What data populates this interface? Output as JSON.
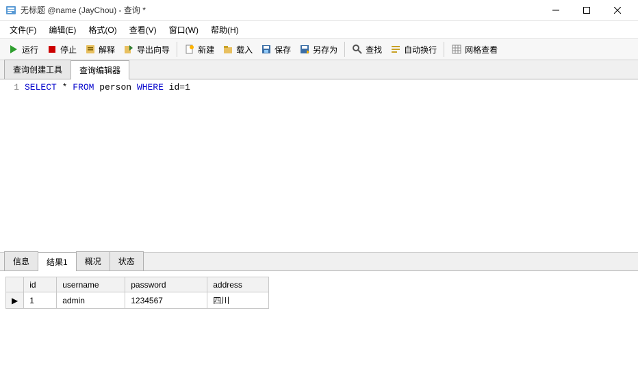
{
  "window": {
    "title": "无标题 @name (JayChou) - 查询 *"
  },
  "menubar": {
    "file": "文件(F)",
    "edit": "编辑(E)",
    "format": "格式(O)",
    "view": "查看(V)",
    "window": "窗口(W)",
    "help": "帮助(H)"
  },
  "toolbar": {
    "run": "运行",
    "stop": "停止",
    "explain": "解释",
    "export_wizard": "导出向导",
    "new": "新建",
    "load": "载入",
    "save": "保存",
    "save_as": "另存为",
    "find": "查找",
    "word_wrap": "自动换行",
    "grid_view": "网格查看"
  },
  "upper_tabs": {
    "query_builder": "查询创建工具",
    "query_editor": "查询编辑器"
  },
  "editor": {
    "line_number": "1",
    "kw_select": "SELECT",
    "star": " * ",
    "kw_from": "FROM",
    "table": " person ",
    "kw_where": "WHERE",
    "cond": " id=1"
  },
  "result_tabs": {
    "messages": "信息",
    "result1": "结果1",
    "profile": "概况",
    "status": "状态"
  },
  "result": {
    "columns": {
      "id": "id",
      "username": "username",
      "password": "password",
      "address": "address"
    },
    "rows": [
      {
        "marker": "▶",
        "id": "1",
        "username": "admin",
        "password": "1234567",
        "address": "四川"
      }
    ]
  }
}
